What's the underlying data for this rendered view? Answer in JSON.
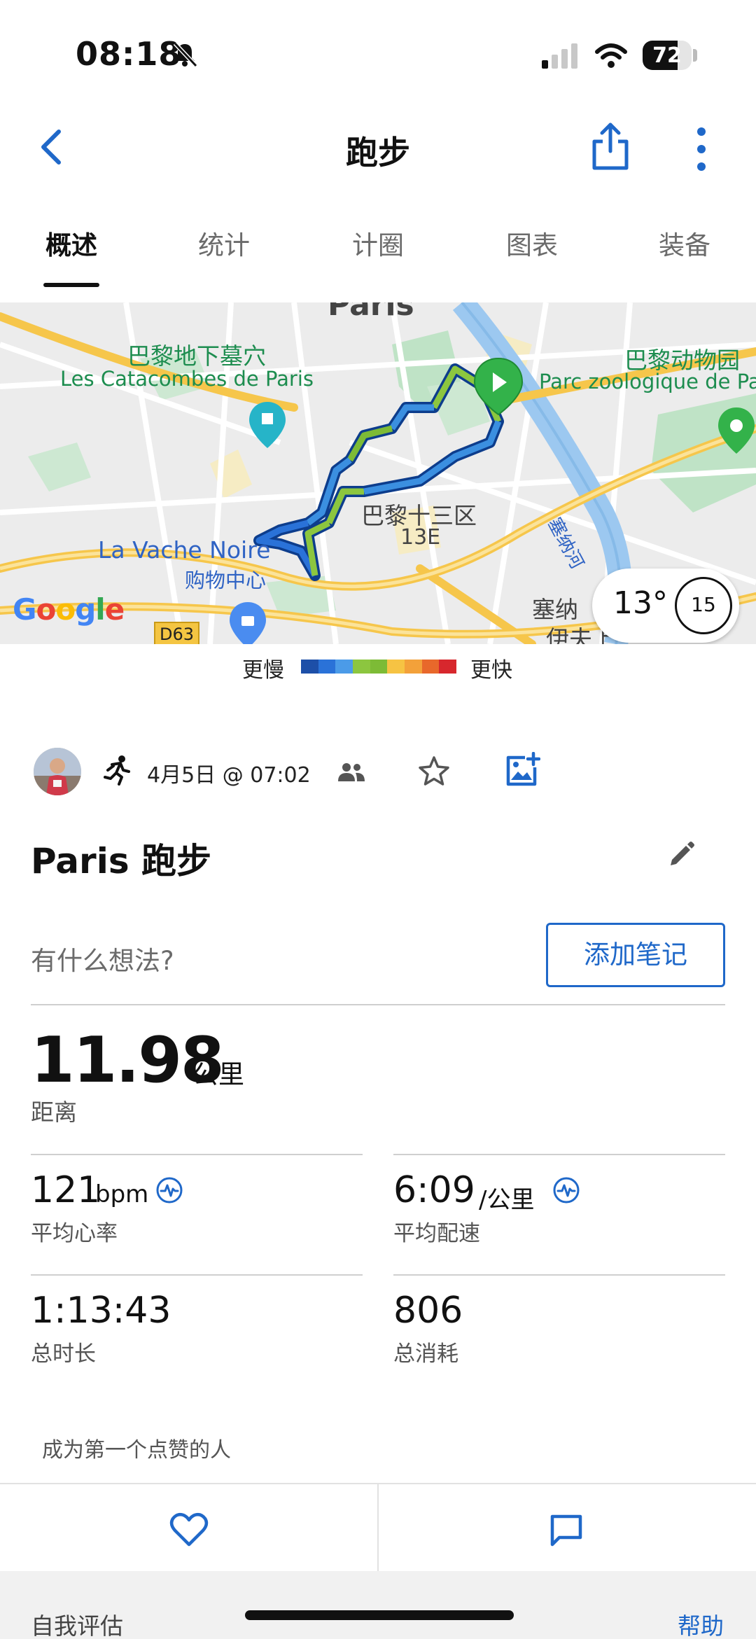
{
  "status_bar": {
    "time": "08:18",
    "battery": "72",
    "battery_level": 0.72,
    "icons": [
      "bell-slash-icon",
      "signal-icon",
      "wifi-icon",
      "battery-icon"
    ]
  },
  "header": {
    "title": "跑步",
    "icons": [
      "chevron-left-icon",
      "share-icon",
      "more-vertical-icon"
    ]
  },
  "tabs": [
    {
      "label": "概述",
      "active": true
    },
    {
      "label": "统计",
      "active": false
    },
    {
      "label": "计圈",
      "active": false
    },
    {
      "label": "图表",
      "active": false
    },
    {
      "label": "装备",
      "active": false
    }
  ],
  "map": {
    "labels": {
      "top_cut": "Paris",
      "catacombs_cn": "巴黎地下墓穴",
      "catacombs_fr": "Les Catacombes de Paris",
      "zoo_cn": "巴黎动物园",
      "zoo_fr": "Parc zoologique de Paris",
      "district_cn": "巴黎十三区",
      "district_code": "13E",
      "mall_fr": "La Vache Noire",
      "mall_cn": "购物中心",
      "river": "塞纳河",
      "seine_cut": "塞纳",
      "bottom_cut": "伊夫上",
      "road": "D63",
      "google": "Google"
    },
    "weather": {
      "temperature": "13°",
      "wind": "15"
    }
  },
  "pace_legend": {
    "slow": "更慢",
    "fast": "更快",
    "colors": [
      "#1d4fa8",
      "#2a72d8",
      "#4b9be8",
      "#8cc63f",
      "#7dbb36",
      "#f6c343",
      "#f3a13a",
      "#e8682b",
      "#d7272d"
    ]
  },
  "activity": {
    "date": "4月5日 @ 07:02",
    "title": "Paris 跑步",
    "note_prompt": "有什么想法?",
    "add_note": "添加笔记",
    "distance": {
      "value": "11.98",
      "unit": "公里",
      "label": "距离"
    },
    "stats": {
      "heart_rate": {
        "value": "121",
        "unit": "bpm",
        "label": "平均心率"
      },
      "pace": {
        "value": "6:09",
        "unit": "/公里",
        "label": "平均配速"
      },
      "duration": {
        "value": "1:13:43",
        "label": "总时长"
      },
      "calories": {
        "value": "806",
        "label": "总消耗"
      }
    }
  },
  "social": {
    "likes_text": "成为第一个点赞的人"
  },
  "footer": {
    "self_eval": "自我评估",
    "help": "帮助"
  }
}
